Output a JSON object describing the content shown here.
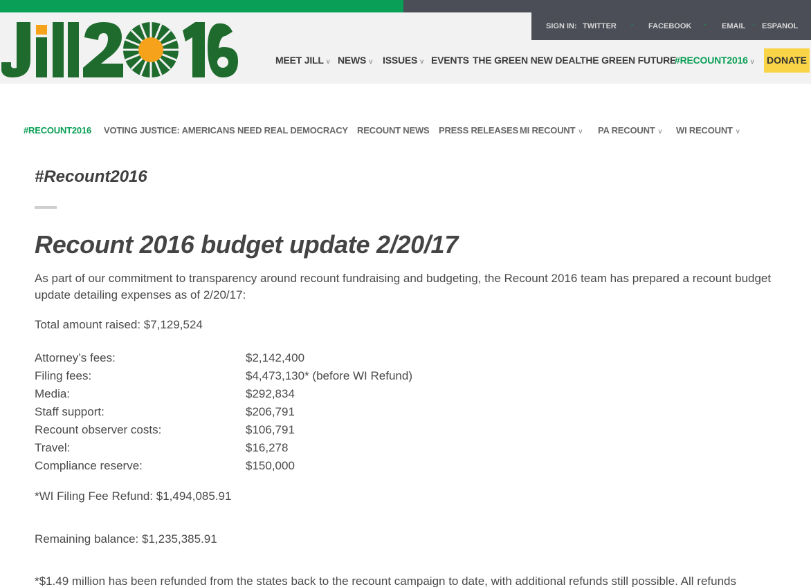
{
  "brand": {
    "logo_text": "Jill2016",
    "colors": {
      "green": "#0a9f56",
      "dark_green": "#1f6b2e",
      "dark_bar": "#4b4d57",
      "sun": "#f7a21b",
      "donate": "#f8d446"
    }
  },
  "utility_nav": {
    "items": [
      "SIGN IN:",
      "TWITTER",
      "FACEBOOK",
      "EMAIL",
      "ESPANOL"
    ],
    "separator": "·"
  },
  "main_nav": {
    "items": [
      {
        "label": "MEET JILL",
        "caret": "v"
      },
      {
        "label": "NEWS",
        "caret": "v"
      },
      {
        "label": "ISSUES",
        "caret": "v"
      },
      {
        "label": "EVENTS"
      },
      {
        "label": "THE GREEN NEW DEAL"
      },
      {
        "label": "THE GREEN FUTURE"
      },
      {
        "label": "#RECOUNT2016",
        "caret": "v"
      }
    ],
    "donate_label": "DONATE"
  },
  "sub_nav": {
    "items": [
      {
        "label": "#RECOUNT2016"
      },
      {
        "label": "VOTING JUSTICE: AMERICANS NEED REAL DEMOCRACY"
      },
      {
        "label": "RECOUNT NEWS"
      },
      {
        "label": "PRESS RELEASES"
      },
      {
        "label": "MI RECOUNT",
        "caret": "v"
      },
      {
        "label": "PA RECOUNT",
        "caret": "v"
      },
      {
        "label": "WI RECOUNT",
        "caret": "v"
      }
    ]
  },
  "content": {
    "section_title": "#Recount2016",
    "post_title": "Recount 2016 budget update 2/20/17",
    "intro": "As part of our commitment to transparency around recount fundraising and budgeting, the Recount 2016 team has prepared a recount budget update detailing expenses as of 2/20/17:",
    "total_raised": "Total amount raised: $7,129,524",
    "budget": [
      {
        "label": "Attorney’s fees:",
        "value": "$2,142,400"
      },
      {
        "label": "Filing fees:",
        "value": "$4,473,130* (before WI Refund)"
      },
      {
        "label": "Media:",
        "value": "$292,834"
      },
      {
        "label": "Staff support:",
        "value": "$206,791"
      },
      {
        "label": "Recount observer costs:",
        "value": "$106,791"
      },
      {
        "label": "Travel:",
        "value": "$16,278"
      },
      {
        "label": "Compliance reserve:",
        "value": "$150,000"
      }
    ],
    "refund": "*WI Filing Fee Refund: $1,494,085.91",
    "remaining": "Remaining balance: $1,235,385.91",
    "footnote": "*$1.49 million has been refunded from the states back to the recount campaign to date, with additional refunds still possible. All refunds"
  }
}
